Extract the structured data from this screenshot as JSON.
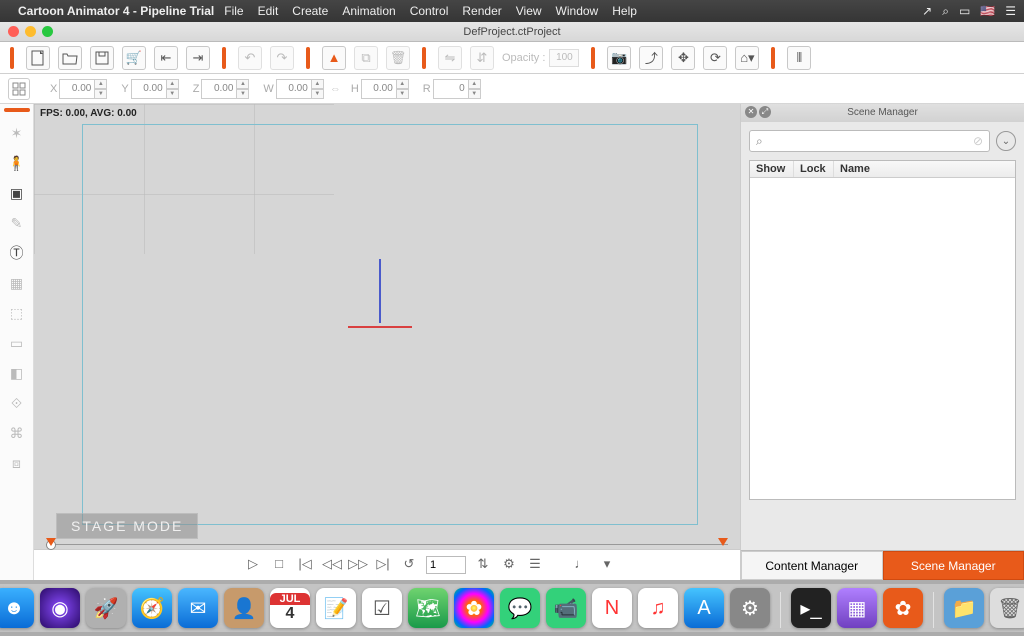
{
  "menubar": {
    "title": "Cartoon Animator 4 - Pipeline Trial",
    "items": [
      "File",
      "Edit",
      "Create",
      "Animation",
      "Control",
      "Render",
      "View",
      "Window",
      "Help"
    ]
  },
  "window": {
    "title": "DefProject.ctProject"
  },
  "toolbar": {
    "opacity_label": "Opacity :",
    "opacity_value": "100"
  },
  "coords": {
    "x": {
      "label": "X",
      "value": "0.00"
    },
    "y": {
      "label": "Y",
      "value": "0.00"
    },
    "z": {
      "label": "Z",
      "value": "0.00"
    },
    "w": {
      "label": "W",
      "value": "0.00"
    },
    "h": {
      "label": "H",
      "value": "0.00"
    },
    "r": {
      "label": "R",
      "value": "0"
    }
  },
  "canvas": {
    "fps_text": "FPS: 0.00, AVG: 0.00",
    "stage_label": "STAGE MODE"
  },
  "timeline": {
    "frame": "1"
  },
  "scene_panel": {
    "title": "Scene Manager",
    "headers": {
      "show": "Show",
      "lock": "Lock",
      "name": "Name"
    },
    "tabs": {
      "content": "Content Manager",
      "scene": "Scene Manager"
    }
  },
  "dock": {
    "apps": [
      "finder",
      "siri",
      "launchpad",
      "safari",
      "mail",
      "contacts",
      "calendar",
      "notes",
      "reminders",
      "maps",
      "photos",
      "messages",
      "facetime",
      "news",
      "itunes",
      "appstore",
      "settings"
    ],
    "right": [
      "terminal",
      "app1",
      "app2",
      "folder",
      "trash"
    ]
  }
}
